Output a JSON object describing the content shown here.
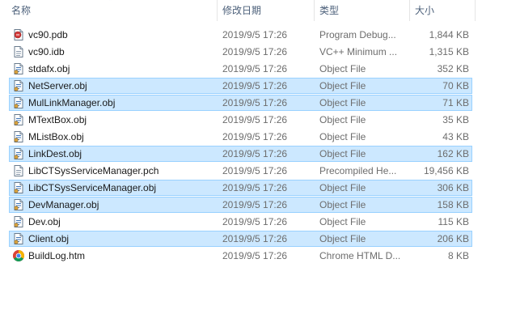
{
  "columns": {
    "name": "名称",
    "date": "修改日期",
    "type": "类型",
    "size": "大小"
  },
  "files": [
    {
      "name": "vc90.pdb",
      "date": "2019/9/5 17:26",
      "type": "Program Debug...",
      "size": "1,844 KB",
      "icon": "pdb-file-icon",
      "selected": false
    },
    {
      "name": "vc90.idb",
      "date": "2019/9/5 17:26",
      "type": "VC++ Minimum ...",
      "size": "1,315 KB",
      "icon": "generic-file-icon",
      "selected": false
    },
    {
      "name": "stdafx.obj",
      "date": "2019/9/5 17:26",
      "type": "Object File",
      "size": "352 KB",
      "icon": "object-file-icon",
      "selected": false
    },
    {
      "name": "NetServer.obj",
      "date": "2019/9/5 17:26",
      "type": "Object File",
      "size": "70 KB",
      "icon": "object-file-icon",
      "selected": true
    },
    {
      "name": "MulLinkManager.obj",
      "date": "2019/9/5 17:26",
      "type": "Object File",
      "size": "71 KB",
      "icon": "object-file-icon",
      "selected": true
    },
    {
      "name": "MTextBox.obj",
      "date": "2019/9/5 17:26",
      "type": "Object File",
      "size": "35 KB",
      "icon": "object-file-icon",
      "selected": false
    },
    {
      "name": "MListBox.obj",
      "date": "2019/9/5 17:26",
      "type": "Object File",
      "size": "43 KB",
      "icon": "object-file-icon",
      "selected": false
    },
    {
      "name": "LinkDest.obj",
      "date": "2019/9/5 17:26",
      "type": "Object File",
      "size": "162 KB",
      "icon": "object-file-icon",
      "selected": true
    },
    {
      "name": "LibCTSysServiceManager.pch",
      "date": "2019/9/5 17:26",
      "type": "Precompiled He...",
      "size": "19,456 KB",
      "icon": "generic-file-icon",
      "selected": false
    },
    {
      "name": "LibCTSysServiceManager.obj",
      "date": "2019/9/5 17:26",
      "type": "Object File",
      "size": "306 KB",
      "icon": "object-file-icon",
      "selected": true
    },
    {
      "name": "DevManager.obj",
      "date": "2019/9/5 17:26",
      "type": "Object File",
      "size": "158 KB",
      "icon": "object-file-icon",
      "selected": true
    },
    {
      "name": "Dev.obj",
      "date": "2019/9/5 17:26",
      "type": "Object File",
      "size": "115 KB",
      "icon": "object-file-icon",
      "selected": false
    },
    {
      "name": "Client.obj",
      "date": "2019/9/5 17:26",
      "type": "Object File",
      "size": "206 KB",
      "icon": "object-file-icon",
      "selected": true
    },
    {
      "name": "BuildLog.htm",
      "date": "2019/9/5 17:26",
      "type": "Chrome HTML D...",
      "size": "8 KB",
      "icon": "chrome-html-icon",
      "selected": false
    }
  ],
  "colors": {
    "selection_fill": "#cce8ff",
    "selection_border": "#99d1ff",
    "header_text": "#4c607a",
    "secondary_text": "#6d6d6d"
  }
}
